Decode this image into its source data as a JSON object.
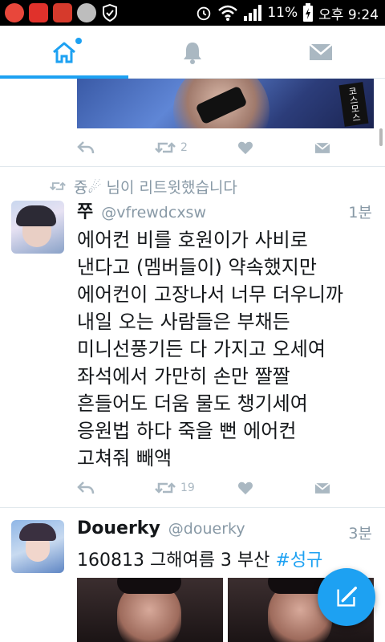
{
  "status_bar": {
    "battery_percent": "11%",
    "time": "오후 9:24"
  },
  "tabs": [
    {
      "name": "home",
      "icon": "home-icon",
      "active": true
    },
    {
      "name": "notifications",
      "icon": "bell-icon",
      "active": false
    },
    {
      "name": "messages",
      "icon": "envelope-icon",
      "active": false
    }
  ],
  "tweet1": {
    "media_watermark": "코스모스",
    "retweet_count": "2"
  },
  "tweet2": {
    "retweeted_by": "즁☄ 님이 리트윗했습니다",
    "name": "쭈",
    "handle": "@vfrewdcxsw",
    "time": "1분",
    "lines": [
      "에어컨 비를 호원이가 사비로",
      "낸다고 (멤버들이) 약속했지만",
      "에어컨이 고장나서 너무 더우니까",
      "내일 오는 사람들은 부채든",
      "미니선풍기든 다 가지고 오세여",
      "좌석에서 가만히 손만 짤짤",
      "흔들어도 더움 물도 챙기세여",
      "응원법 하다 죽을 뻔 에어컨",
      "고쳐줘 빼액"
    ],
    "retweet_count": "19"
  },
  "tweet3": {
    "name": "Douerky",
    "handle": "@douerky",
    "time": "3분",
    "text": "160813 그해여름 3  부산 ",
    "hashtag": "#성규"
  },
  "colors": {
    "accent": "#1da1f2",
    "muted": "#8899a6",
    "icon_gray": "#aab8c2"
  }
}
